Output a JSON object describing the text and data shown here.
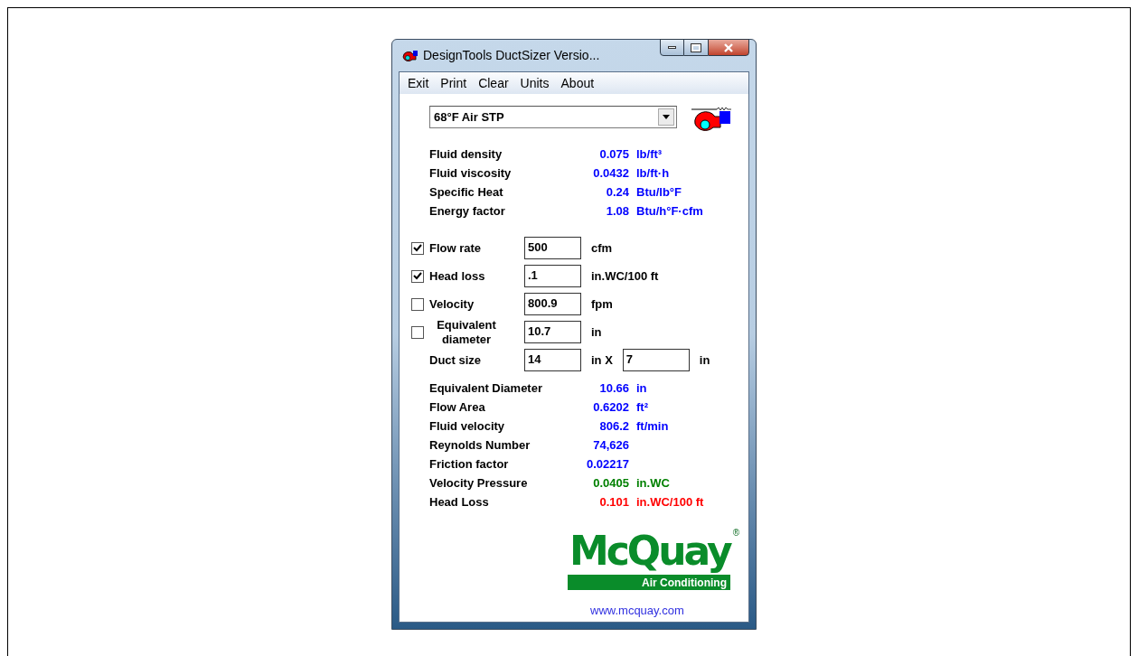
{
  "window": {
    "title": "DesignTools DuctSizer Versio..."
  },
  "menu": [
    "Exit",
    "Print",
    "Clear",
    "Units",
    "About"
  ],
  "fluid_select": {
    "value": "68°F Air STP"
  },
  "properties": [
    {
      "label": "Fluid density",
      "value": "0.075",
      "unit": "lb/ft³",
      "color": "#0000ff"
    },
    {
      "label": "Fluid viscosity",
      "value": "0.0432",
      "unit": "lb/ft·h",
      "color": "#0000ff"
    },
    {
      "label": "Specific Heat",
      "value": "0.24",
      "unit": "Btu/lb°F",
      "color": "#0000ff"
    },
    {
      "label": "Energy factor",
      "value": "1.08",
      "unit": "Btu/h°F·cfm",
      "color": "#0000ff"
    }
  ],
  "inputs": [
    {
      "kind": "checkbox",
      "label": "Flow rate",
      "checked": true,
      "value": "500",
      "unit": "cfm"
    },
    {
      "kind": "checkbox",
      "label": "Head loss",
      "checked": true,
      "value": ".1",
      "unit": "in.WC/100 ft"
    },
    {
      "kind": "checkbox",
      "label": "Velocity",
      "checked": false,
      "value": "800.9",
      "unit": "fpm"
    },
    {
      "kind": "checkbox",
      "label": "Equivalent diameter",
      "checked": false,
      "value": "10.7",
      "unit": "in"
    },
    {
      "kind": "pair",
      "label": "Duct size",
      "value": "14",
      "unit": "in X",
      "value_2": "7",
      "unit_2": "in"
    }
  ],
  "results": [
    {
      "label": "Equivalent Diameter",
      "value": "10.66",
      "unit": "in",
      "color": "#0000ff"
    },
    {
      "label": "Flow Area",
      "value": "0.6202",
      "unit": "ft²",
      "color": "#0000ff"
    },
    {
      "label": "Fluid velocity",
      "value": "806.2",
      "unit": "ft/min",
      "color": "#0000ff"
    },
    {
      "label": "Reynolds Number",
      "value": "74,626",
      "color": "#0000ff"
    },
    {
      "label": "Friction factor",
      "value": "0.02217",
      "color": "#0000ff"
    },
    {
      "label": "Velocity Pressure",
      "value": "0.0405",
      "unit": "in.WC",
      "color": "#008000"
    },
    {
      "label": "Head Loss",
      "value": "0.101",
      "unit": "in.WC/100 ft",
      "color": "#ff0000"
    }
  ],
  "logo": {
    "name": "McQuay",
    "mark": "®",
    "tagline": "Air Conditioning"
  },
  "link": "www.mcquay.com"
}
